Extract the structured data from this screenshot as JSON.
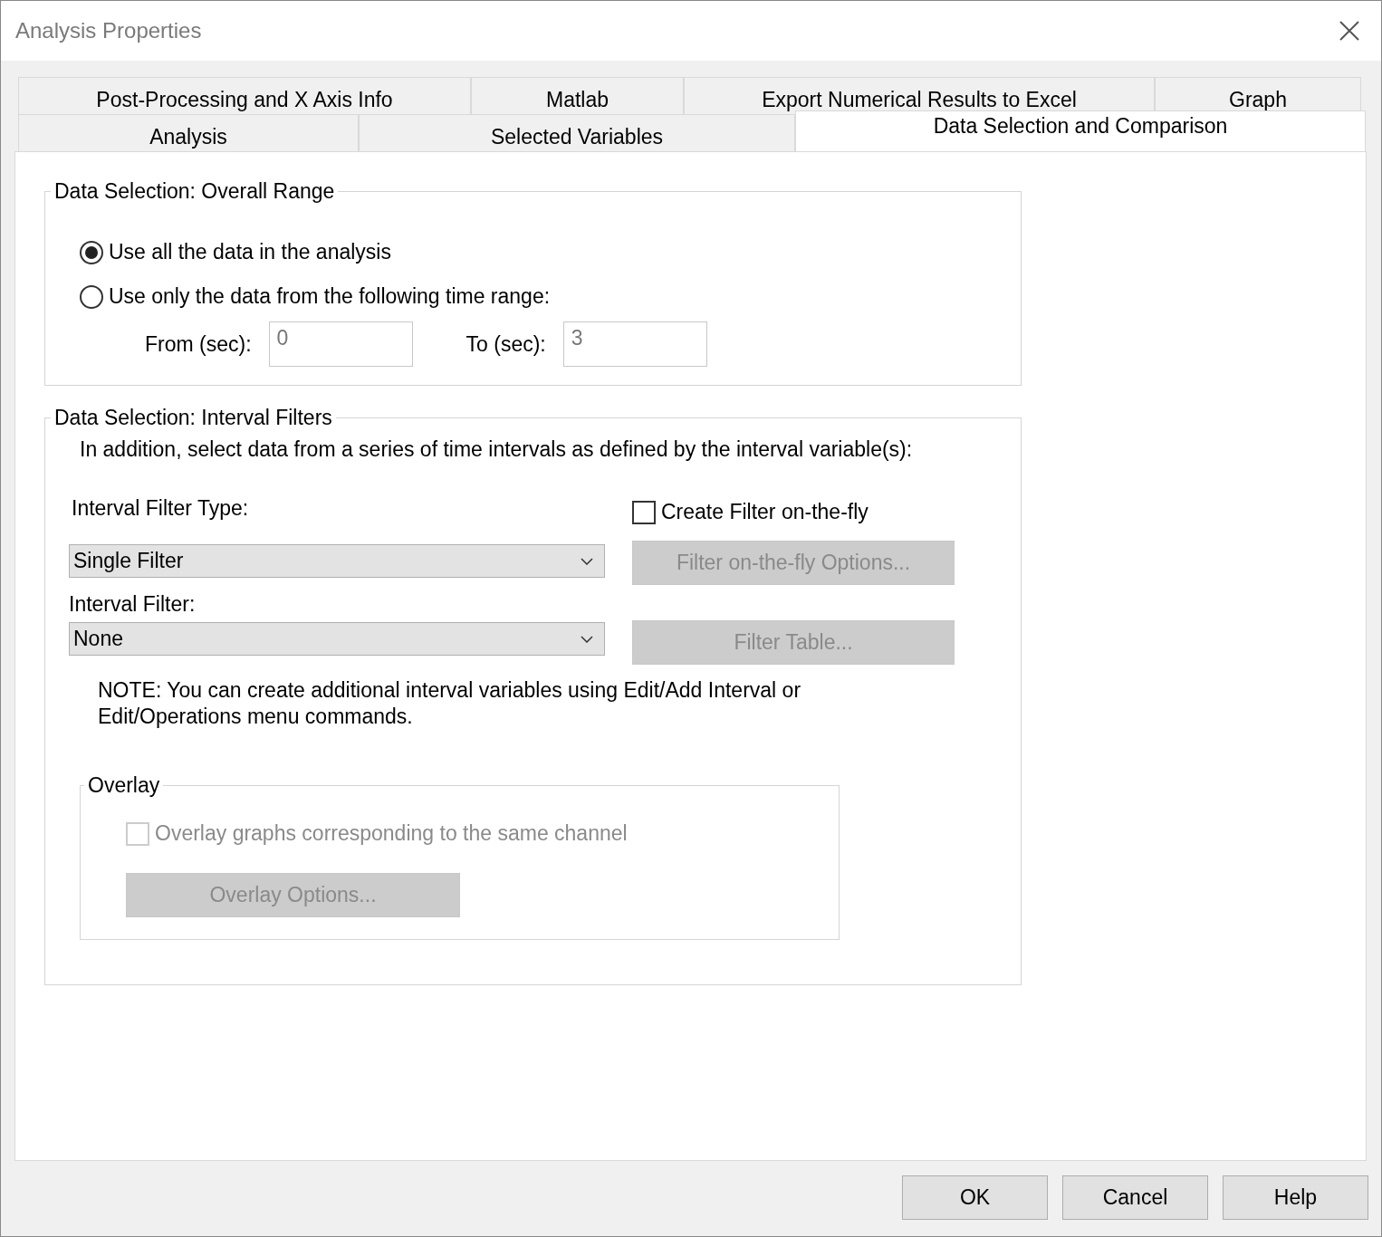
{
  "window": {
    "title": "Analysis Properties"
  },
  "tab_rows": [
    [
      {
        "label": "Post-Processing and X Axis Info",
        "selected": false
      },
      {
        "label": "Matlab",
        "selected": false
      },
      {
        "label": "Export Numerical Results to Excel",
        "selected": false
      },
      {
        "label": "Graph",
        "selected": false
      }
    ],
    [
      {
        "label": "Analysis",
        "selected": false
      },
      {
        "label": "Selected Variables",
        "selected": false
      },
      {
        "label": "Data Selection and Comparison",
        "selected": true
      }
    ]
  ],
  "overall_range": {
    "title": "Data Selection: Overall Range",
    "options": [
      {
        "label": "Use all the data in the analysis",
        "selected": true
      },
      {
        "label": "Use only the data from the following time range:",
        "selected": false
      }
    ],
    "fields": [
      {
        "label": "From (sec):",
        "value": "0"
      },
      {
        "label": "To (sec):",
        "value": "3"
      }
    ]
  },
  "interval_filters": {
    "title": "Data Selection: Interval Filters",
    "description": "In addition, select data from a series of time intervals as defined by the interval variable(s):",
    "filter_type_label": "Interval Filter Type:",
    "filter_type_value": "Single Filter",
    "create_on_the_fly": {
      "label": "Create Filter on-the-fly",
      "checked": false
    },
    "on_the_fly_button": {
      "label": "Filter on-the-fly Options...",
      "disabled": true
    },
    "filter_label": "Interval Filter:",
    "filter_value": "None",
    "filter_table_button": {
      "label": "Filter Table...",
      "disabled": true
    },
    "note": "NOTE: You can create additional interval variables using Edit/Add Interval or Edit/Operations menu commands.",
    "overlay": {
      "title": "Overlay",
      "checkbox": {
        "label": "Overlay graphs corresponding to the same channel",
        "checked": false,
        "disabled": true
      },
      "button": {
        "label": "Overlay Options...",
        "disabled": true
      }
    }
  },
  "buttons": [
    "OK",
    "Cancel",
    "Help"
  ]
}
